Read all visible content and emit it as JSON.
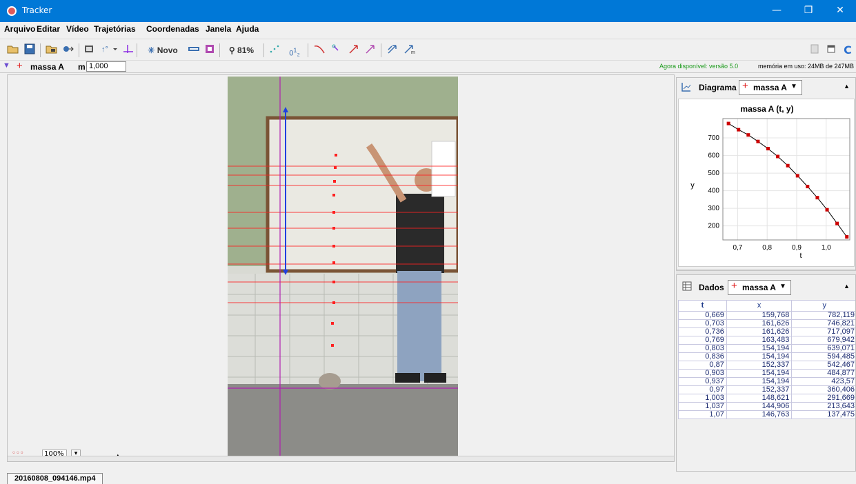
{
  "window": {
    "title": "Tracker",
    "minimize": "—",
    "restore": "❐",
    "close": "✕"
  },
  "menu": [
    "Arquivo",
    "Editar",
    "Vídeo",
    "Trajetórias",
    "Coordenadas",
    "Janela",
    "Ajuda"
  ],
  "toolbar": {
    "new_label": "Novo",
    "zoom": "81%",
    "icons": [
      "open-folder-icon",
      "save-icon",
      "open-video-icon",
      "import-icon",
      "clip-settings-icon",
      "calibration-icon",
      "axes-icon",
      "new-track-icon",
      "tape-icon",
      "filter-icon",
      "zoom-icon",
      "trail-icon",
      "label-icon",
      "path-icon",
      "velocity-icon",
      "accel-icon",
      "force-icon",
      "momentum-icon",
      "refresh-icon"
    ]
  },
  "trackbar": {
    "track_name": "massa A",
    "mass_label": "m",
    "mass_value": "1,000",
    "update_notice": "Agora disponível: versão 5.0",
    "memory": "memória em uso: 24MB de 247MB"
  },
  "plot_panel": {
    "title": "Diagrama",
    "track": "massa A"
  },
  "data_panel": {
    "title": "Dados",
    "track": "massa A"
  },
  "chart_data": {
    "type": "line",
    "title": "massa A (t, y)",
    "xlabel": "t",
    "ylabel": "y",
    "xlim": [
      0.65,
      1.08
    ],
    "ylim": [
      120,
      810
    ],
    "xticks": [
      "0,7",
      "0,8",
      "0,9",
      "1,0"
    ],
    "xtick_values": [
      0.7,
      0.8,
      0.9,
      1.0
    ],
    "yticks": [
      "200",
      "300",
      "400",
      "500",
      "600",
      "700"
    ],
    "ytick_values": [
      200,
      300,
      400,
      500,
      600,
      700
    ],
    "series": [
      {
        "x": [
          0.669,
          0.703,
          0.736,
          0.769,
          0.803,
          0.836,
          0.87,
          0.903,
          0.937,
          0.97,
          1.003,
          1.037,
          1.07
        ],
        "y": [
          782.119,
          746.821,
          717.097,
          679.942,
          639.071,
          594.485,
          542.467,
          484.877,
          423.57,
          360.406,
          291.669,
          213.643,
          137.475
        ]
      }
    ],
    "color": "#cc0000"
  },
  "table": {
    "columns": [
      "t",
      "x",
      "y"
    ],
    "rows": [
      [
        "0,669",
        "159,768",
        "782,119"
      ],
      [
        "0,703",
        "161,626",
        "746,821"
      ],
      [
        "0,736",
        "161,626",
        "717,097"
      ],
      [
        "0,769",
        "163,483",
        "679,942"
      ],
      [
        "0,803",
        "154,194",
        "639,071"
      ],
      [
        "0,836",
        "154,194",
        "594,485"
      ],
      [
        "0,87",
        "152,337",
        "542,467"
      ],
      [
        "0,903",
        "154,194",
        "484,877"
      ],
      [
        "0,937",
        "154,194",
        "423,57"
      ],
      [
        "0,97",
        "152,337",
        "360,406"
      ],
      [
        "1,003",
        "148,621",
        "291,669"
      ],
      [
        "1,037",
        "144,906",
        "213,643"
      ],
      [
        "1,07",
        "146,763",
        "137,475"
      ]
    ]
  },
  "video": {
    "file_tab": "20160808_094146.mp4",
    "zoom": "100%"
  }
}
